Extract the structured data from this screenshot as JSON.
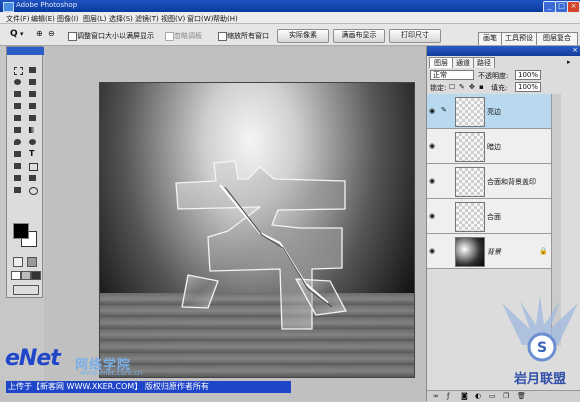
{
  "window": {
    "title": "Adobe Photoshop"
  },
  "menu": {
    "items": [
      "文件(F)",
      "编辑(E)",
      "图像(I)",
      "图层(L)",
      "选择(S)",
      "滤镜(T)",
      "视图(V)",
      "窗口(W)",
      "帮助(H)"
    ]
  },
  "options": {
    "zoom_symbol": "Q",
    "fit_window_label": "调整窗口大小以满屏显示",
    "ignore_palettes_label": "忽略调板",
    "zoom_all_label": "缩放所有窗口",
    "actual_pixels": "实际像素",
    "fit_screen": "满画布显示",
    "print_size": "打印尺寸",
    "palette_tabs": [
      "画笔",
      "工具预设",
      "图层复合"
    ]
  },
  "layers_panel": {
    "tabs": [
      "图层",
      "通道",
      "路径"
    ],
    "blend_mode": "正常",
    "opacity_label": "不透明度:",
    "opacity_value": "100%",
    "lock_label": "锁定:",
    "fill_label": "填充:",
    "fill_value": "100%",
    "layers": [
      {
        "name": "亮边",
        "selected": true
      },
      {
        "name": "暗边",
        "selected": false
      },
      {
        "name": "合面和背景盖印",
        "selected": false
      },
      {
        "name": "合面",
        "selected": false
      },
      {
        "name": "背景",
        "selected": false
      }
    ]
  },
  "watermark": {
    "credit": "上传于【新客网 WWW.XKER.COM】 版权归原作者所有",
    "brand": "eNet",
    "brand_cn": "网络学院",
    "brand_url": "www.enet.com.cn",
    "corner_logo_text": "岩月联盟"
  },
  "colors": {
    "accent_blue": "#1f46c9",
    "selection": "#b9d9f0"
  }
}
